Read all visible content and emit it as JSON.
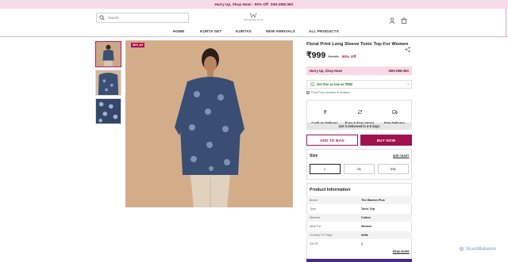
{
  "announcement": {
    "text": "Hurry Up, Shop Now! - 50% Off",
    "timer": "00H:29M:39S"
  },
  "header": {
    "search_placeholder": "Search",
    "logo_text": "THE WOMEN PLUS"
  },
  "nav": [
    "HOME",
    "KURTA SET",
    "KURTAS",
    "NEW ARRIVALS",
    "ALL PRODUCTS"
  ],
  "gallery": {
    "badge": "50% off",
    "thumbnails": 3
  },
  "product": {
    "title": "Floral Print Long Sleeve Tunic Top For Women",
    "price": "₹999",
    "mrp": "₹1,995",
    "discount": "50% Off",
    "hurry_text": "Hurry Up, Shop Now!",
    "hurry_timer": "00H:29M:39S",
    "offer_text": "Get this as low as ₹850",
    "final_price_note": "Final Price Inclusive of all taxes",
    "features": [
      "Cash on Delivery",
      "Easy 5 days return",
      "Free Delivery"
    ],
    "delivery": "Get it delivered in 4-9 days",
    "add_to_bag": "ADD TO BAG",
    "buy_now": "BUY NOW"
  },
  "size": {
    "label": "Size",
    "chart_link": "SIZE CHART",
    "options": [
      "L",
      "XL",
      "2XL"
    ],
    "selected": "L"
  },
  "info": {
    "title": "Product Information",
    "rows": [
      {
        "key": "Brand",
        "value": "The Women Plus"
      },
      {
        "key": "Type",
        "value": "Tunic Top"
      },
      {
        "key": "Material",
        "value": "Cotton"
      },
      {
        "key": "Ideal For",
        "value": "Women"
      },
      {
        "key": "Country Of Origin",
        "value": "India"
      },
      {
        "key": "Set Of",
        "value": "1"
      }
    ],
    "read_more": "READ MORE"
  },
  "watermark": "ScanMalware",
  "colors": {
    "accent": "#a0114f",
    "banner": "#f6dbe7"
  }
}
